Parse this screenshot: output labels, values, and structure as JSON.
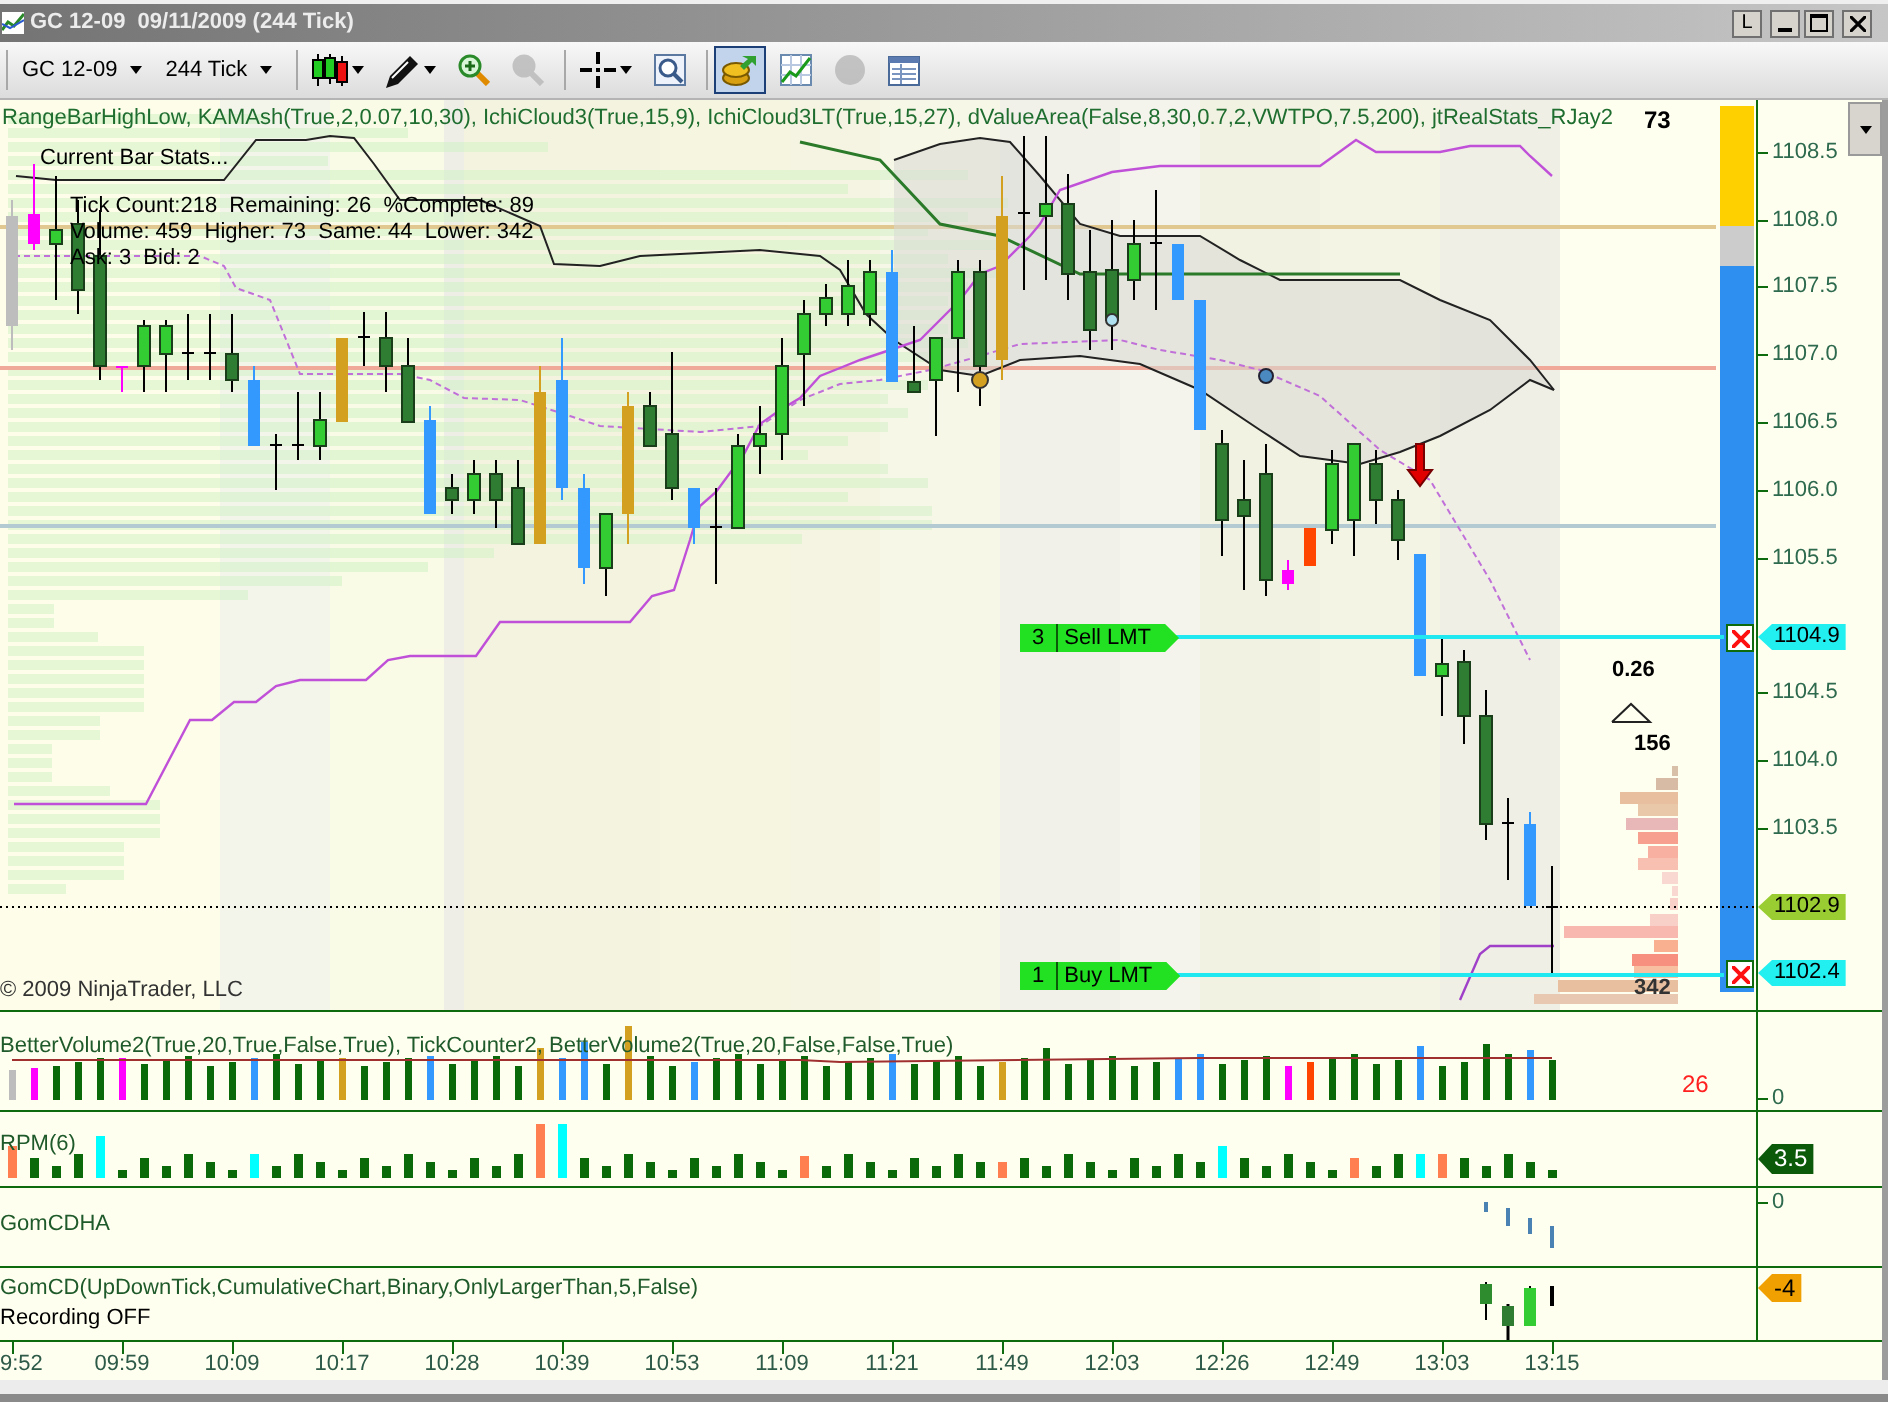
{
  "window": {
    "title": "GC 12-09  09/11/2009 (244 Tick)",
    "pin_button": "L"
  },
  "toolbar": {
    "selectors": [
      {
        "label": "GC 12-09"
      },
      {
        "label": "244 Tick"
      }
    ],
    "tools": [
      {
        "selected": false,
        "disabled": false
      },
      {
        "selected": false,
        "disabled": false
      },
      {
        "selected": false,
        "disabled": false
      },
      {
        "selected": false,
        "disabled": true
      },
      {
        "selected": false,
        "disabled": false
      },
      {
        "selected": false,
        "disabled": false
      },
      {
        "selected": true,
        "disabled": false
      },
      {
        "selected": false,
        "disabled": false
      },
      {
        "selected": false,
        "disabled": true
      },
      {
        "selected": false,
        "disabled": false
      }
    ]
  },
  "price_panel": {
    "indicators": "RangeBarHighLow, KAMAsh(True,2,0.07,10,30), IchiCloud3(True,15,9), IchiCloud3LT(True,15,27), dValueArea(False,8,30,0.7,2,VWTPO,7.5,200), jtRealStats_RJay2",
    "stats_value": "73",
    "bar_stats": {
      "title": "Current Bar Stats...",
      "lines": [
        "Tick Count:218  Remaining: 26  %Complete: 89",
        "Volume: 459  Higher: 73  Same: 44  Lower: 342",
        "Ask: 3  Bid: 2"
      ]
    },
    "orders": [
      {
        "quantity": "3",
        "label": "Sell LMT",
        "price": "1104.9"
      },
      {
        "quantity": "1",
        "label": "Buy LMT",
        "price": "1102.4"
      }
    ],
    "last_price": "1102.9",
    "ratio": "0.26",
    "upper_volume": "156",
    "lower_volume": "342",
    "copyright": "© 2009 NinjaTrader, LLC",
    "price_ticks": [
      "1108.5",
      "1108.0",
      "1107.5",
      "1107.0",
      "1106.5",
      "1106.0",
      "1105.5",
      "1104.5",
      "1104.0",
      "1103.5"
    ]
  },
  "volume_panel": {
    "label": "BetterVolume2(True,20,True,False,True), TickCounter2, BetterVolume2(True,20,False,False,True)",
    "tick_count": "26",
    "axis_ticks": [
      "0"
    ]
  },
  "rpm_panel": {
    "label": "RPM(6)",
    "value_tag": "3.5"
  },
  "delta_ha_panel": {
    "label": "GomCDHA",
    "axis_ticks": [
      "0"
    ]
  },
  "delta_panel": {
    "label": "GomCD(UpDownTick,CumulativeChart,Binary,OnlyLargerThan,5,False)",
    "status": "Recording OFF",
    "value_tag": "-4"
  },
  "time_axis": {
    "ticks": [
      "9:52",
      "09:59",
      "10:09",
      "10:17",
      "10:28",
      "10:39",
      "10:53",
      "11:09",
      "11:21",
      "11:49",
      "12:03",
      "12:26",
      "12:49",
      "13:03",
      "13:15"
    ]
  }
}
